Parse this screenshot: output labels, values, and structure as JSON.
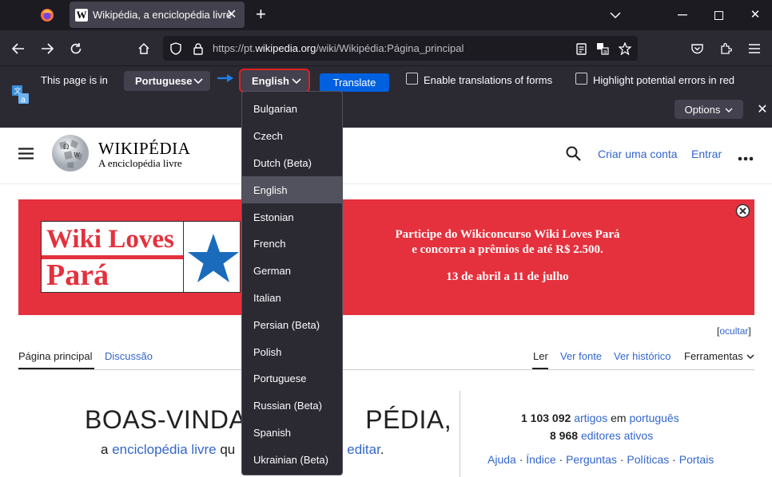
{
  "browser": {
    "tab_title": "Wikipédia, a enciclopédia livre",
    "new_tab": "+",
    "url_prefix": "https://pt.",
    "url_domain": "wikipedia.org",
    "url_path": "/wiki/Wikipédia:Página_principal"
  },
  "translation_bar": {
    "page_is_in": "This page is in",
    "from_language": "Portuguese",
    "to_language": "English",
    "translate_button": "Translate",
    "enable_forms": "Enable translations of forms",
    "highlight_errors": "Highlight potential errors in red",
    "options": "Options",
    "languages": [
      "Bulgarian",
      "Czech",
      "Dutch (Beta)",
      "English",
      "Estonian",
      "French",
      "German",
      "Italian",
      "Persian (Beta)",
      "Polish",
      "Portuguese",
      "Russian (Beta)",
      "Spanish",
      "Ukrainian (Beta)"
    ],
    "selected_index": 3
  },
  "wiki": {
    "logo_title": "WIKIPÉDIA",
    "logo_subtitle": "A enciclopédia livre",
    "create_account": "Criar uma conta",
    "login": "Entrar",
    "banner_logo_line1": "Wiki Loves",
    "banner_logo_line2": "Pará",
    "banner_line1": "Participe do Wikiconcurso Wiki Loves Pará",
    "banner_line2": "e concorra a prêmios de até R$ 2.500.",
    "banner_line3": "13 de abril a 11 de julho",
    "hide": "ocultar",
    "tab_main": "Página principal",
    "tab_discussion": "Discussão",
    "tab_read": "Ler",
    "tab_source": "Ver fonte",
    "tab_history": "Ver histórico",
    "tab_tools": "Ferramentas",
    "welcome_title_a": "BOAS-VINDAS",
    "welcome_title_b": "PÉDIA,",
    "welcome_a": "a ",
    "welcome_link1": "enciclopédia livre",
    "welcome_mid": " qu",
    "welcome_link2": "editar",
    "welcome_end": ".",
    "articles_count": "1 103 092",
    "articles_label": "artigos",
    "articles_in": "em",
    "articles_lang": "português",
    "editors_count": "8 968",
    "editors_label": "editores ativos",
    "footer_links": [
      "Ajuda",
      "Índice",
      "Perguntas",
      "Políticas",
      "Portais"
    ]
  },
  "colors": {
    "accent": "#0061e0",
    "selected_outline": "#e02020",
    "banner": "#e4313d",
    "link": "#3366cc"
  }
}
